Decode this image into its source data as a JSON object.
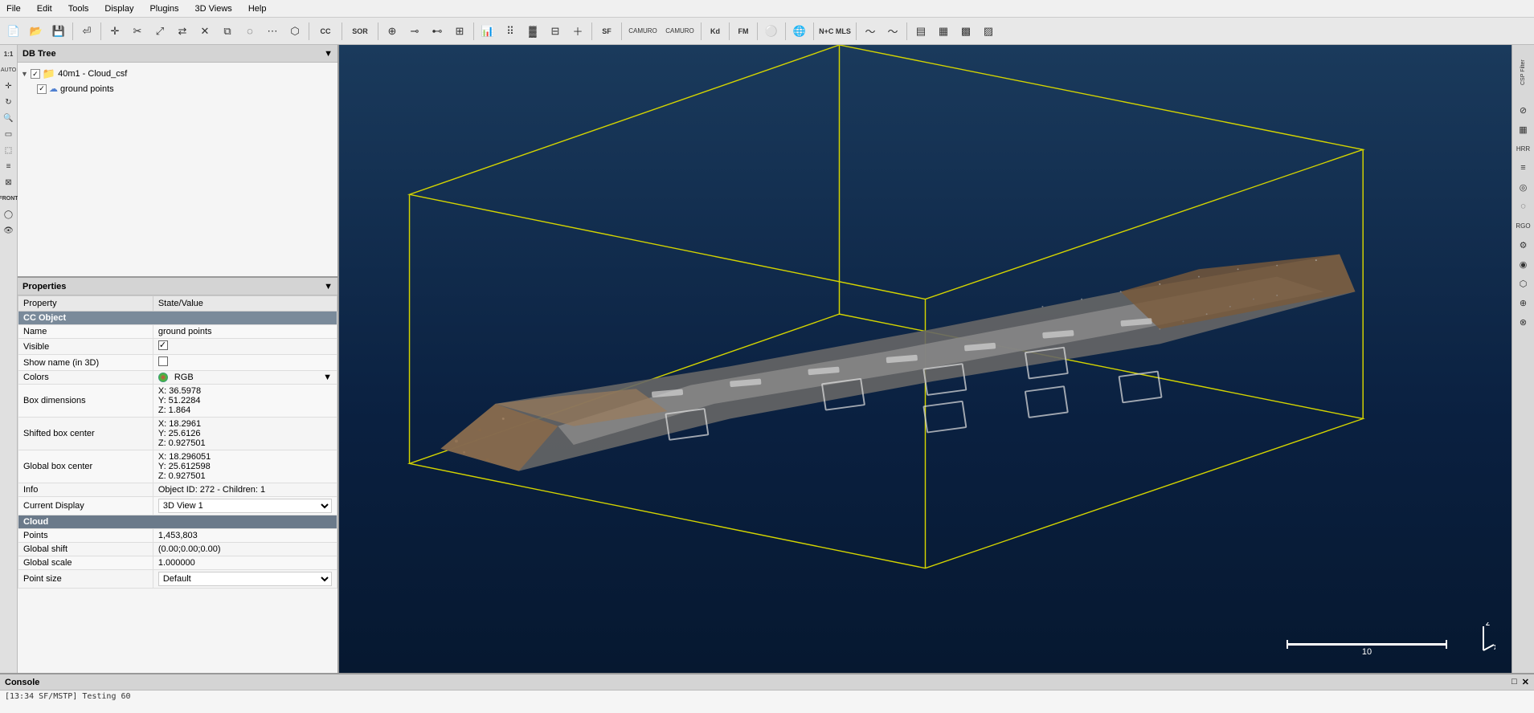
{
  "menubar": {
    "items": [
      "File",
      "Edit",
      "Tools",
      "Display",
      "Plugins",
      "3D Views",
      "Help"
    ]
  },
  "toolbar": {
    "buttons": [
      {
        "name": "new",
        "icon": "📄"
      },
      {
        "name": "open",
        "icon": "📂"
      },
      {
        "name": "save",
        "icon": "💾"
      },
      {
        "name": "sep1",
        "icon": "|"
      },
      {
        "name": "select",
        "icon": "↖"
      },
      {
        "name": "translate",
        "icon": "✛"
      },
      {
        "name": "rotate",
        "icon": "↻"
      },
      {
        "name": "scale",
        "icon": "⤢"
      }
    ]
  },
  "db_tree": {
    "title": "DB Tree",
    "items": [
      {
        "label": "40m1 - Cloud_csf",
        "type": "folder",
        "checked": true,
        "expanded": true
      },
      {
        "label": "ground points",
        "type": "cloud",
        "checked": true,
        "indent": true
      }
    ]
  },
  "properties": {
    "title": "Properties",
    "column_property": "Property",
    "column_value": "State/Value",
    "sections": [
      {
        "type": "section",
        "label": "CC Object"
      },
      {
        "property": "Name",
        "value": "ground points"
      },
      {
        "property": "Visible",
        "value": "checkbox_checked"
      },
      {
        "property": "Show name (in 3D)",
        "value": "checkbox_unchecked"
      },
      {
        "property": "Colors",
        "value": "RGB",
        "hasColorSwatch": true,
        "hasDropdown": true
      },
      {
        "property": "Box dimensions",
        "value": "X: 36.5978\nY: 51.2284\nZ: 1.864"
      },
      {
        "property": "Shifted box center",
        "value": "X: 18.2961\nY: 25.6126\nZ: 0.927501"
      },
      {
        "property": "Global box center",
        "value": "X: 18.296051\nY: 25.612598\nZ: 0.927501"
      },
      {
        "property": "Info",
        "value": "Object ID: 272 - Children: 1"
      },
      {
        "property": "Current Display",
        "value": "3D View 1",
        "hasDropdown": true
      },
      {
        "type": "cloud_section",
        "label": "Cloud"
      },
      {
        "property": "Points",
        "value": "1,453,803"
      },
      {
        "property": "Global shift",
        "value": "(0.00;0.00;0.00)"
      },
      {
        "property": "Global scale",
        "value": "1.000000"
      },
      {
        "property": "Point size",
        "value": "Default",
        "hasDropdown": true
      }
    ]
  },
  "console": {
    "title": "Console",
    "text": "[13:34 SF/MSTP] Testing 60"
  },
  "viewport": {
    "scale_bar_label": "10",
    "view_name": "3D View 1"
  },
  "right_panel": {
    "tools": [
      {
        "name": "ban",
        "icon": "🚫"
      },
      {
        "name": "grid",
        "icon": "▦"
      },
      {
        "name": "layers",
        "icon": "≡"
      },
      {
        "name": "color",
        "icon": "◉"
      },
      {
        "name": "lasso",
        "icon": "⬡"
      },
      {
        "name": "info",
        "icon": "ℹ"
      },
      {
        "name": "settings",
        "icon": "⚙"
      },
      {
        "name": "plugin1",
        "icon": "◎"
      },
      {
        "name": "plugin2",
        "icon": "⬤"
      },
      {
        "name": "plugin3",
        "icon": "⊕"
      },
      {
        "name": "plugin4",
        "icon": "⊗"
      }
    ],
    "label": "CSP Filter"
  },
  "window_controls": {
    "minimize": "−",
    "restore": "□",
    "close": "✕"
  }
}
